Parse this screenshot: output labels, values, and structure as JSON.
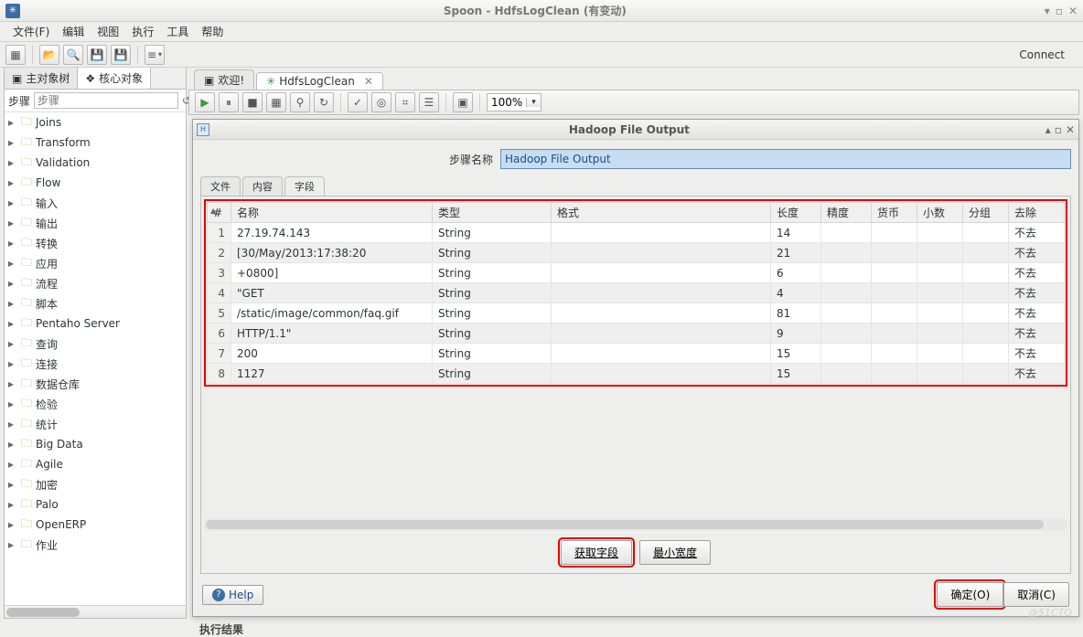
{
  "window": {
    "title": "Spoon - HdfsLogClean (有变动)"
  },
  "menu": {
    "file": "文件(F)",
    "edit": "编辑",
    "view": "视图",
    "run": "执行",
    "tools": "工具",
    "help": "帮助"
  },
  "toolbar": {
    "connect": "Connect"
  },
  "leftpane": {
    "tab1": "主对象树",
    "tab2": "核心对象",
    "stepslabel": "步骤",
    "items": [
      "Joins",
      "Transform",
      "Validation",
      "Flow",
      "输入",
      "输出",
      "转换",
      "应用",
      "流程",
      "脚本",
      "Pentaho Server",
      "查询",
      "连接",
      "数据仓库",
      "检验",
      "统计",
      "Big Data",
      "Agile",
      "加密",
      "Palo",
      "OpenERP",
      "作业"
    ]
  },
  "tabs": {
    "welcome": "欢迎!",
    "trans": "HdfsLogClean"
  },
  "canvas": {
    "zoom": "100%"
  },
  "dialog": {
    "title": "Hadoop File Output",
    "step_name_label": "步骤名称",
    "step_name_value": "Hadoop File Output",
    "subtabs": {
      "file": "文件",
      "content": "内容",
      "fields": "字段"
    },
    "columns": {
      "name": "名称",
      "type": "类型",
      "format": "格式",
      "length": "长度",
      "precision": "精度",
      "currency": "货币",
      "decimal": "小数",
      "group": "分组",
      "remove": "去除"
    },
    "rows": [
      {
        "n": "1",
        "name": "27.19.74.143",
        "type": "String",
        "format": "",
        "length": "14",
        "precision": "",
        "currency": "",
        "decimal": "",
        "group": "",
        "remove": "不去"
      },
      {
        "n": "2",
        "name": "[30/May/2013:17:38:20",
        "type": "String",
        "format": "",
        "length": "21",
        "precision": "",
        "currency": "",
        "decimal": "",
        "group": "",
        "remove": "不去"
      },
      {
        "n": "3",
        "name": "+0800]",
        "type": "String",
        "format": "",
        "length": "6",
        "precision": "",
        "currency": "",
        "decimal": "",
        "group": "",
        "remove": "不去"
      },
      {
        "n": "4",
        "name": "\"GET",
        "type": "String",
        "format": "",
        "length": "4",
        "precision": "",
        "currency": "",
        "decimal": "",
        "group": "",
        "remove": "不去"
      },
      {
        "n": "5",
        "name": "/static/image/common/faq.gif",
        "type": "String",
        "format": "",
        "length": "81",
        "precision": "",
        "currency": "",
        "decimal": "",
        "group": "",
        "remove": "不去"
      },
      {
        "n": "6",
        "name": "HTTP/1.1\"",
        "type": "String",
        "format": "",
        "length": "9",
        "precision": "",
        "currency": "",
        "decimal": "",
        "group": "",
        "remove": "不去"
      },
      {
        "n": "7",
        "name": "200",
        "type": "String",
        "format": "",
        "length": "15",
        "precision": "",
        "currency": "",
        "decimal": "",
        "group": "",
        "remove": "不去"
      },
      {
        "n": "8",
        "name": "1127",
        "type": "String",
        "format": "",
        "length": "15",
        "precision": "",
        "currency": "",
        "decimal": "",
        "group": "",
        "remove": "不去"
      }
    ],
    "buttons": {
      "get_fields": "获取字段",
      "min_width": "最小宽度",
      "ok": "确定(O)",
      "cancel": "取消(C)",
      "help": "Help"
    }
  },
  "bottom": {
    "result": "执行结果"
  }
}
